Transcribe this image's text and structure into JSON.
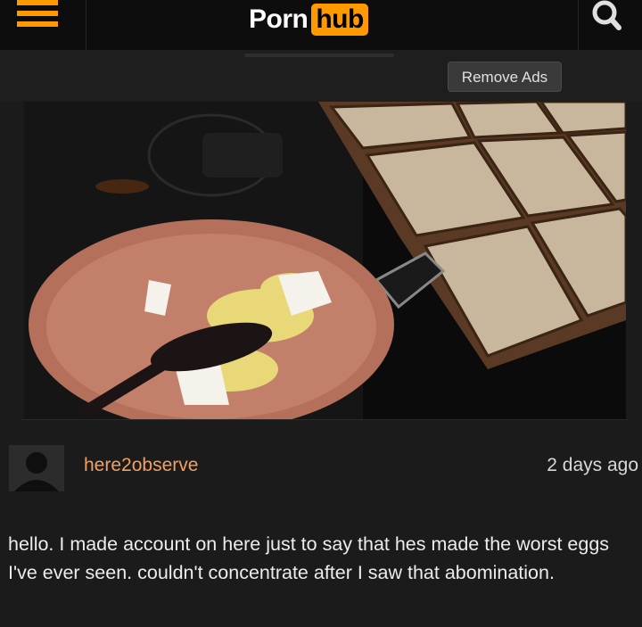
{
  "header": {
    "logo_primary": "Porn",
    "logo_accent": "hub",
    "menu_icon": "hamburger-menu-icon",
    "search_icon": "search-icon",
    "accent_color": "#ff9900"
  },
  "ad_bar": {
    "remove_ads_label": "Remove Ads"
  },
  "video": {
    "icon": "video-player"
  },
  "comment": {
    "avatar_icon": "default-avatar-icon",
    "username": "here2observe",
    "timestamp": "2 days ago",
    "text": "hello. I made account on here just to say that hes made the worst eggs I've ever seen. couldn't concentrate after I saw that abomination.",
    "username_color": "#f2a060"
  }
}
